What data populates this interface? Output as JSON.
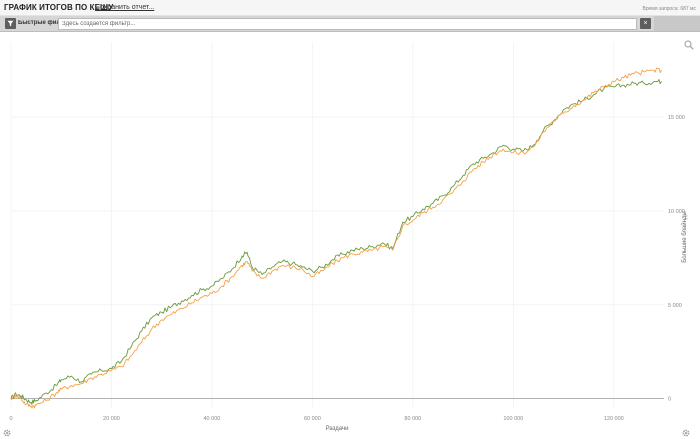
{
  "header": {
    "title": "ГРАФИК ИТОГОВ ПО КЕШУ",
    "save_report_label": "Сохранить отчет...",
    "query_time": "Время запроса: 687 мс"
  },
  "filter_bar": {
    "quick_filters_label": "Быстрые фильтры",
    "input_placeholder": "Здесь создается фильтр...",
    "clear_symbol": "×"
  },
  "colors": {
    "series_green": "#6a9a3a",
    "series_orange": "#f4a24a",
    "zero_line": "#999999",
    "grid": "#eeeeee"
  },
  "icons": [
    "filter-icon",
    "close-icon",
    "zoom-icon",
    "gear-icon"
  ],
  "chart_data": {
    "type": "line",
    "title": "",
    "xlabel": "Раздачи",
    "ylabel": "Большие блайнды",
    "xlim": [
      0,
      130000
    ],
    "ylim": [
      -500,
      19000
    ],
    "x_ticks": [
      0,
      20000,
      40000,
      60000,
      80000,
      100000,
      120000
    ],
    "x_tick_labels": [
      "0",
      "20 000",
      "40 000",
      "60 000",
      "80 000",
      "100 000",
      "120 000"
    ],
    "y_ticks": [
      0,
      5000,
      10000,
      15000
    ],
    "y_tick_labels": [
      "0",
      "5 000",
      "10 000",
      "15 000"
    ],
    "grid": true,
    "series": [
      {
        "color": "#6a9a3a",
        "x": [
          0,
          1000,
          2000,
          3000,
          4000,
          5000,
          7000,
          9000,
          10000,
          12000,
          14000,
          16000,
          18000,
          20000,
          22000,
          24000,
          26000,
          28000,
          30000,
          32000,
          34000,
          36000,
          38000,
          40000,
          42000,
          44000,
          46000,
          47000,
          48000,
          50000,
          52000,
          54000,
          56000,
          58000,
          60000,
          62000,
          64000,
          66000,
          68000,
          70000,
          72000,
          74000,
          76000,
          78000,
          80000,
          82000,
          84000,
          86000,
          88000,
          90000,
          92000,
          94000,
          96000,
          98000,
          100000,
          102000,
          104000,
          106000,
          108000,
          110000,
          112000,
          114000,
          116000,
          118000,
          120000,
          122000,
          124000,
          126000,
          128000,
          129500
        ],
        "y": [
          0,
          250,
          150,
          -50,
          -200,
          -100,
          300,
          700,
          1000,
          1200,
          900,
          1300,
          1500,
          1600,
          2000,
          2800,
          3600,
          4300,
          4600,
          4900,
          5200,
          5500,
          5800,
          6000,
          6400,
          6900,
          7600,
          7800,
          7000,
          6600,
          7000,
          7300,
          7200,
          7000,
          6800,
          7000,
          7400,
          7700,
          7900,
          8000,
          8100,
          8300,
          8000,
          9400,
          9700,
          10100,
          10400,
          10800,
          11300,
          11900,
          12500,
          12800,
          13100,
          13500,
          13300,
          13200,
          13500,
          14300,
          14800,
          15400,
          15700,
          15900,
          16200,
          16500,
          16600,
          16700,
          16800,
          16800,
          16900,
          16900
        ]
      },
      {
        "color": "#f4a24a",
        "x": [
          0,
          1000,
          2000,
          3000,
          4000,
          5000,
          7000,
          9000,
          10000,
          12000,
          14000,
          16000,
          18000,
          20000,
          22000,
          24000,
          26000,
          28000,
          30000,
          32000,
          34000,
          36000,
          38000,
          40000,
          42000,
          44000,
          46000,
          47000,
          48000,
          50000,
          52000,
          54000,
          56000,
          58000,
          60000,
          62000,
          64000,
          66000,
          68000,
          70000,
          72000,
          74000,
          76000,
          78000,
          80000,
          82000,
          84000,
          86000,
          88000,
          90000,
          92000,
          94000,
          96000,
          98000,
          100000,
          102000,
          104000,
          106000,
          108000,
          110000,
          112000,
          114000,
          116000,
          118000,
          120000,
          122000,
          124000,
          126000,
          128000,
          129500
        ],
        "y": [
          0,
          200,
          0,
          -300,
          -400,
          -350,
          -100,
          300,
          500,
          700,
          800,
          1100,
          1300,
          1500,
          1700,
          2300,
          3000,
          3700,
          4200,
          4500,
          4800,
          5100,
          5400,
          5600,
          6000,
          6500,
          7100,
          7300,
          6800,
          6400,
          6800,
          7100,
          7000,
          6900,
          6500,
          6800,
          7200,
          7500,
          7700,
          7800,
          7900,
          8100,
          7900,
          9200,
          9500,
          9900,
          10200,
          10600,
          11000,
          11600,
          12200,
          12600,
          13000,
          13300,
          13100,
          13100,
          13400,
          14200,
          14800,
          15200,
          15600,
          15900,
          16300,
          16600,
          16900,
          17100,
          17300,
          17400,
          17500,
          17500
        ]
      }
    ]
  }
}
